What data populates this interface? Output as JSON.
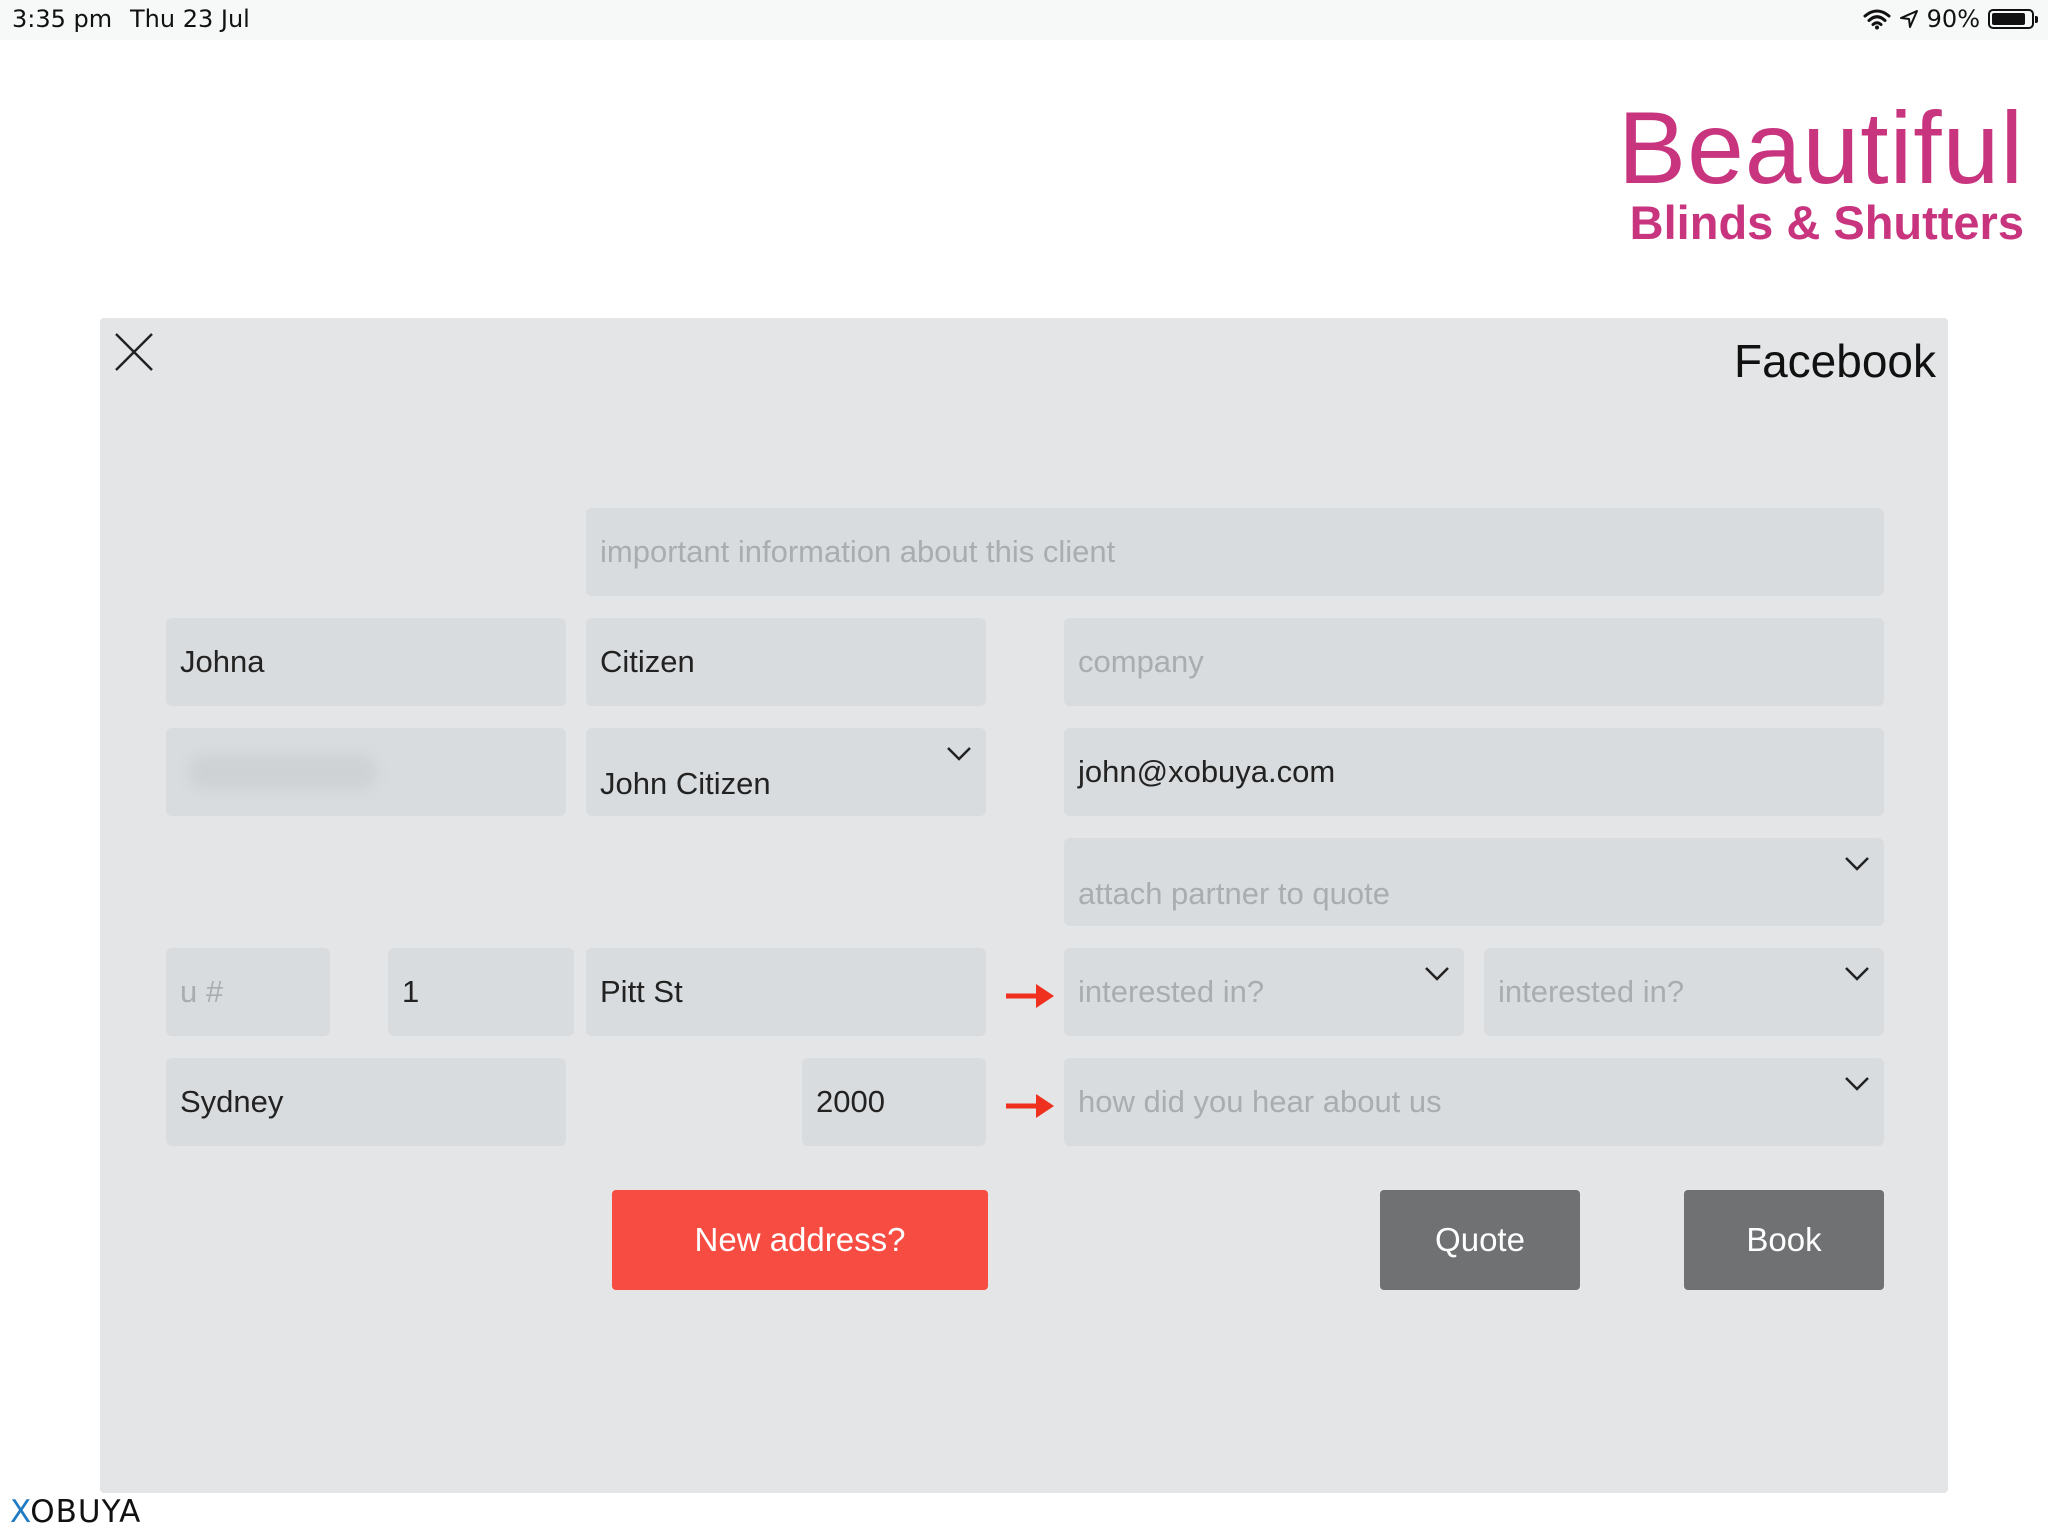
{
  "status_bar": {
    "time": "3:35 pm",
    "date": "Thu 23 Jul",
    "battery": "90%",
    "icons": [
      "wifi-icon",
      "location-arrow-icon",
      "battery-icon"
    ]
  },
  "brand": {
    "line1": "Beautiful",
    "line2": "Blinds & Shutters",
    "color": "#c8347e"
  },
  "panel": {
    "source": "Facebook",
    "notes": {
      "value": "",
      "placeholder": "important information about this client"
    },
    "first_name": "Johna",
    "last_name": "Citizen",
    "company": {
      "value": "",
      "placeholder": "company"
    },
    "contact_select": "John Citizen",
    "email": "john@xobuya.com",
    "partner": {
      "placeholder": "attach partner to quote"
    },
    "unit": {
      "value": "",
      "placeholder": "u #"
    },
    "street_number": "1",
    "street_name": "Pitt St",
    "interested_1": {
      "placeholder": "interested in?"
    },
    "interested_2": {
      "placeholder": "interested in?"
    },
    "suburb": "Sydney",
    "postcode": "2000",
    "hear_about": {
      "placeholder": "how did you hear about us"
    },
    "buttons": {
      "new_address": "New address?",
      "quote": "Quote",
      "book": "Book"
    }
  },
  "footer": {
    "brand_x": "X",
    "brand_rest": "OBUYA"
  },
  "colors": {
    "accent_red": "#f74c42",
    "arrow_red": "#f0301f",
    "button_grey": "#6f7172",
    "panel_bg": "#e3e5e6",
    "brand_x": "#1e7bc4"
  }
}
